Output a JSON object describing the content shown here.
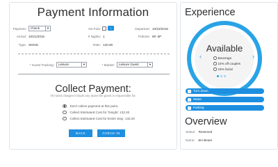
{
  "header": {
    "title": "Payment Information"
  },
  "details": {
    "payment_label": "Payment:",
    "payment_value": "Check",
    "no_post_label": "No Post:",
    "departure_label": "Departure:",
    "departure_value": "10/22/2015",
    "arrival_label": "Arrival:",
    "arrival_value": "10/21/2015",
    "nights_label": "# Nights:",
    "nights_value": "1",
    "policies_label": "Policies:",
    "policies_value": "6P, 6P",
    "type_label": "Type:",
    "type_value": "SKING",
    "rate_label": "Rate:",
    "rate_value": "120.00"
  },
  "tracking": {
    "guest_label": "* Guest Tracking:",
    "guest_value": "Leisure",
    "market_label": "* Market:",
    "market_value": "Leisure Guest"
  },
  "collect": {
    "title": "Collect Payment:",
    "subtitle": "All noted charges include any taxes the guest is responsible for.",
    "options": [
      "Don't collect payment at this point.",
      "Collect Estimated Cost for Tonight: 133.20",
      "Collect Estimated Cost for Entire Stay: 133.20"
    ],
    "selected_index": 0,
    "back_label": "BACK",
    "checkin_label": "CHECK IN"
  },
  "experience": {
    "title": "Experience",
    "available_title": "Available",
    "available_items": [
      "Beverage",
      "15% off couples",
      "15% facial"
    ],
    "pills": [
      "Turn down",
      "Water",
      "Parking"
    ]
  },
  "overview": {
    "title": "Overview",
    "status_label": "Status:",
    "status_value": "Reserved",
    "name_label": "Name:",
    "name_value": "Jim Beam"
  },
  "colors": {
    "accent": "#1e8fe0",
    "ring": "#29a3e6"
  }
}
